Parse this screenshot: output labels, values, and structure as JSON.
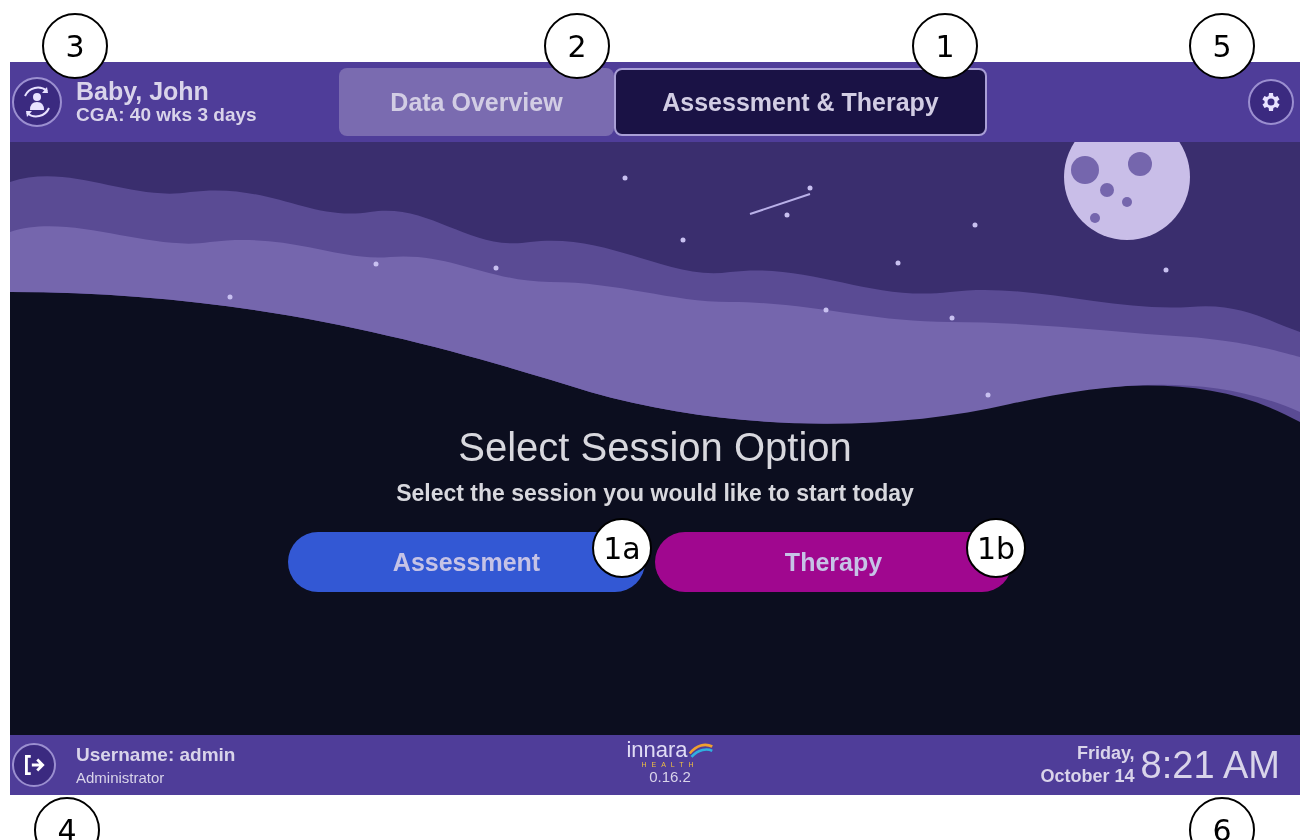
{
  "header": {
    "patient_name": "Baby, John",
    "cga": "CGA: 40 wks 3 days",
    "tabs": [
      {
        "label": "Data Overview",
        "selected": false
      },
      {
        "label": "Assessment & Therapy",
        "selected": true
      }
    ]
  },
  "main": {
    "title": "Select Session Option",
    "subtitle": "Select the session you would like to start today",
    "options": [
      {
        "label": "Assessment",
        "color": "#3358d4"
      },
      {
        "label": "Therapy",
        "color": "#a0078f"
      }
    ]
  },
  "footer": {
    "username": "Username: admin",
    "role": "Administrator",
    "logo_word": "innara",
    "logo_sub": "HEALTH",
    "version": "0.16.2",
    "day": "Friday,",
    "date": "October 14",
    "time": "8:21 AM"
  },
  "callouts": [
    {
      "label": "3"
    },
    {
      "label": "2"
    },
    {
      "label": "1"
    },
    {
      "label": "5"
    },
    {
      "label": "1a"
    },
    {
      "label": "1b"
    },
    {
      "label": "4"
    },
    {
      "label": "6"
    }
  ]
}
